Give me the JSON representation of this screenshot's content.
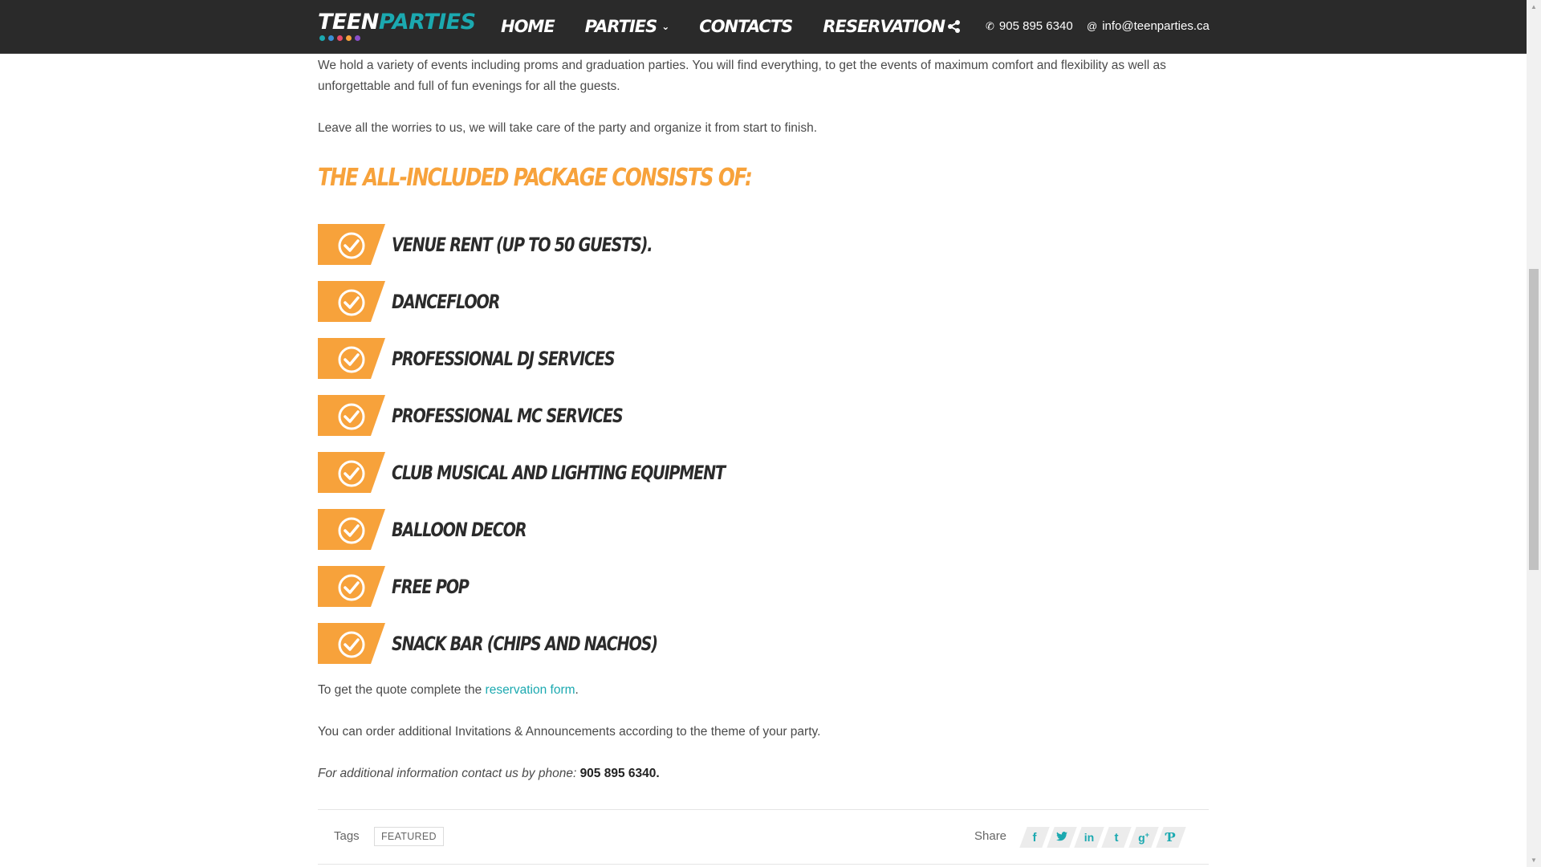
{
  "header": {
    "logo": {
      "teen": "TEEN",
      "parties": "PARTIES",
      "dot_colors": [
        "#1ba9b0",
        "#3a8fd6",
        "#e64a6b",
        "#f7a23b",
        "#8a4fc9"
      ]
    },
    "nav": {
      "home": "HOME",
      "parties": "PARTIES",
      "contacts": "CONTACTS",
      "reservation": "RESERVATION"
    },
    "phone": "905 895 6340",
    "email": "info@teenparties.ca"
  },
  "content": {
    "intro": "We hold a variety of events including proms and graduation parties. You will find everything, to get the events of maximum comfort and flexibility as well as unforgettable and full of fun evenings for all the guests.",
    "worries": "Leave all the worries to us, we will take care of the party and organize it from start to finish.",
    "heading": "THE ALL-INCLUDED PACKAGE CONSISTS OF:",
    "package_items": [
      "VENUE RENT (UP TO 50 GUESTS).",
      "DANCEFLOOR",
      "PROFESSIONAL DJ SERVICES",
      "PROFESSIONAL MC SERVICES",
      "CLUB MUSICAL AND LIGHTING EQUIPMENT",
      "BALLOON DECOR",
      "FREE POP",
      "SNACK BAR (CHIPS AND NACHOS)"
    ],
    "quote_prefix": "To get the quote complete the ",
    "quote_link": "reservation form",
    "quote_suffix": ".",
    "invitations": "You can order additional Invitations & Announcements according to the theme of your party.",
    "additional_info": "For additional information contact us by phone:",
    "additional_phone": "905 895 6340."
  },
  "footer_meta": {
    "tags_label": "Tags",
    "tag": "FEATURED",
    "share_label": "Share"
  },
  "colors": {
    "accent_orange": "#f7a23b",
    "accent_teal": "#1ba9b0",
    "header_bg": "#2a2a2a"
  },
  "icons": [
    "share-icon",
    "phone-icon",
    "at-icon",
    "check-circle-icon",
    "facebook-icon",
    "twitter-icon",
    "linkedin-icon",
    "tumblr-icon",
    "google-plus-icon",
    "pinterest-icon"
  ]
}
